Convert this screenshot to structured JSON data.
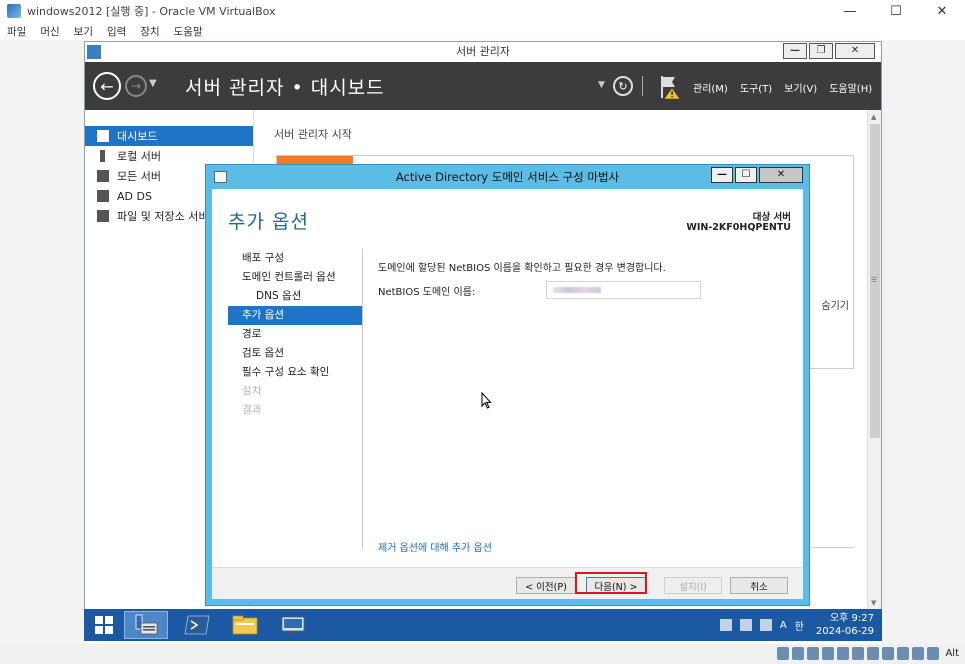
{
  "vbox": {
    "title": "windows2012 [실행 중] - Oracle VM VirtualBox",
    "menu": [
      "파일",
      "머신",
      "보기",
      "입력",
      "장치",
      "도움말"
    ],
    "status_key": "Alt"
  },
  "server_manager": {
    "window_title": "서버 관리자",
    "header_title": "서버 관리자 • 대시보드",
    "menu": [
      "관리(M)",
      "도구(T)",
      "보기(V)",
      "도움말(H)"
    ],
    "sidebar": [
      {
        "label": "대시보드",
        "active": true
      },
      {
        "label": "로컬 서버",
        "active": false
      },
      {
        "label": "모든 서버",
        "active": false
      },
      {
        "label": "AD DS",
        "active": false
      },
      {
        "label": "파일 및 저장소 서비",
        "active": false
      }
    ],
    "content_heading": "서버 관리자 시작",
    "hide_label": "숨기기"
  },
  "wizard": {
    "title": "Active Directory 도메인 서비스 구성 마법사",
    "page_title": "추가 옵션",
    "target_server_label": "대상 서버",
    "target_server_name": "WIN-2KF0HQPENTU",
    "nav": [
      {
        "label": "배포 구성",
        "state": "normal",
        "indent": false
      },
      {
        "label": "도메인 컨트롤러 옵션",
        "state": "normal",
        "indent": false
      },
      {
        "label": "DNS 옵션",
        "state": "normal",
        "indent": true
      },
      {
        "label": "추가 옵션",
        "state": "active",
        "indent": false
      },
      {
        "label": "경로",
        "state": "normal",
        "indent": false
      },
      {
        "label": "검토 옵션",
        "state": "normal",
        "indent": false
      },
      {
        "label": "필수 구성 요소 확인",
        "state": "normal",
        "indent": false
      },
      {
        "label": "설치",
        "state": "disabled",
        "indent": false
      },
      {
        "label": "결과",
        "state": "disabled",
        "indent": false
      }
    ],
    "description": "도메인에 할당된 NetBIOS 이름을 확인하고 필요한 경우 변경합니다.",
    "netbios_label": "NetBIOS 도메인 이름:",
    "more_link": "제거 옵션에 대해 추가 옵션",
    "buttons": {
      "prev": "< 이전(P)",
      "next": "다음(N) >",
      "install": "설치(I)",
      "cancel": "취소"
    }
  },
  "tray": {
    "time": "오후 9:27",
    "date": "2024-06-29",
    "ime_a": "A",
    "ime_han": "한"
  },
  "colors": {
    "accent": "#1e74c7",
    "wizard_frame": "#5bbde6",
    "header_bg": "#3c3c3c",
    "taskbar": "#1b5aa3",
    "highlight": "#e0141e"
  }
}
